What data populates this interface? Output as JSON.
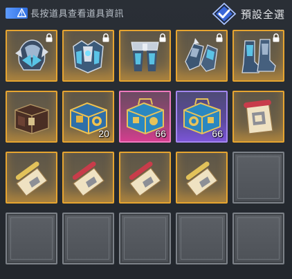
{
  "header": {
    "hint_text": "長按道具查看道具資訊",
    "select_all_label": "預設全選"
  },
  "colors": {
    "accent_blue": "#4f7ff0",
    "gold_frame": "#e7a530",
    "pink_frame": "#f07ac0",
    "purple_frame": "#a487f0"
  },
  "inventory": {
    "row1": [
      {
        "name": "helmet",
        "locked": true
      },
      {
        "name": "chest-armor",
        "locked": true
      },
      {
        "name": "leg-armor",
        "locked": true
      },
      {
        "name": "gauntlets",
        "locked": true
      },
      {
        "name": "boots",
        "locked": true
      }
    ],
    "row2": [
      {
        "name": "dark-chest",
        "count": ""
      },
      {
        "name": "gold-chest",
        "count": "20"
      },
      {
        "name": "blue-chest-pink",
        "count": "66"
      },
      {
        "name": "blue-chest-purple",
        "count": "66"
      },
      {
        "name": "scroll",
        "count": ""
      }
    ],
    "row3": [
      {
        "name": "scroll-gold"
      },
      {
        "name": "scroll-red"
      },
      {
        "name": "scroll-red"
      },
      {
        "name": "scroll-gold"
      }
    ]
  }
}
